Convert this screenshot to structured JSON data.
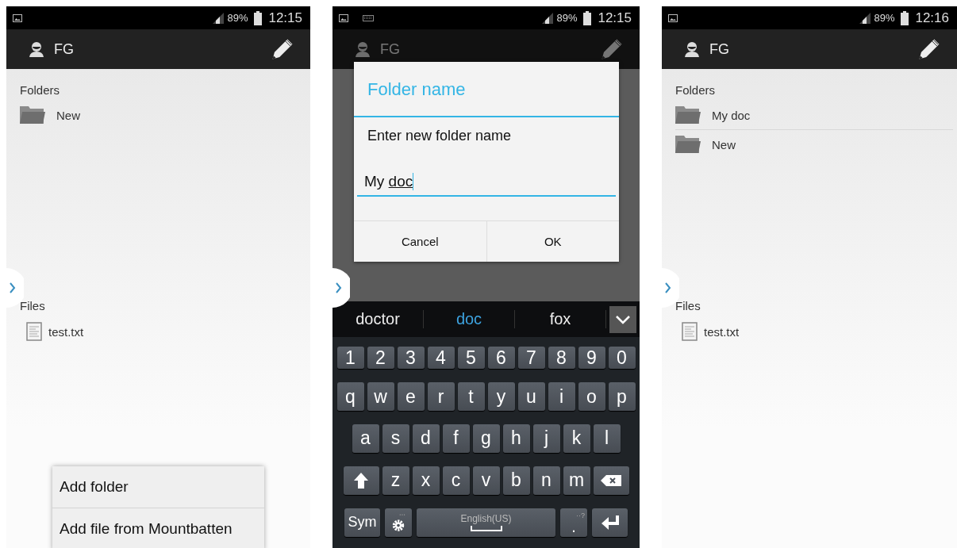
{
  "screens": [
    {
      "kind": "browse",
      "dimmed": false,
      "status_bar": {
        "keyboard_indicator": false,
        "battery": "89%",
        "time": "12:15"
      },
      "app_bar": {
        "title": "FG"
      },
      "folders_heading": "Folders",
      "folders": [
        "New"
      ],
      "files_heading": "Files",
      "files": [
        "test.txt"
      ],
      "menu": {
        "items": [
          "Add folder",
          "Add file from Mountbatten"
        ]
      }
    },
    {
      "kind": "dialog",
      "dimmed": true,
      "status_bar": {
        "keyboard_indicator": true,
        "battery": "89%",
        "time": "12:15"
      },
      "app_bar": {
        "title": "FG"
      },
      "dialog": {
        "title": "Folder name",
        "message": "Enter new folder name",
        "typed": "My ",
        "composing": "doc",
        "buttons": [
          "Cancel",
          "OK"
        ]
      },
      "keyboard": {
        "suggestions": [
          {
            "text": "doctor",
            "selected": false
          },
          {
            "text": "doc",
            "selected": true
          },
          {
            "text": "fox",
            "selected": false
          }
        ],
        "rows": [
          {
            "keys": [
              {
                "kind": "char",
                "label": "1"
              },
              {
                "kind": "char",
                "label": "2"
              },
              {
                "kind": "char",
                "label": "3"
              },
              {
                "kind": "char",
                "label": "4"
              },
              {
                "kind": "char",
                "label": "5"
              },
              {
                "kind": "char",
                "label": "6"
              },
              {
                "kind": "char",
                "label": "7"
              },
              {
                "kind": "char",
                "label": "8"
              },
              {
                "kind": "char",
                "label": "9"
              },
              {
                "kind": "char",
                "label": "0"
              }
            ]
          },
          {
            "keys": [
              {
                "kind": "char",
                "label": "q"
              },
              {
                "kind": "char",
                "label": "w"
              },
              {
                "kind": "char",
                "label": "e"
              },
              {
                "kind": "char",
                "label": "r"
              },
              {
                "kind": "char",
                "label": "t"
              },
              {
                "kind": "char",
                "label": "y"
              },
              {
                "kind": "char",
                "label": "u"
              },
              {
                "kind": "char",
                "label": "i"
              },
              {
                "kind": "char",
                "label": "o"
              },
              {
                "kind": "char",
                "label": "p"
              }
            ]
          },
          {
            "keys": [
              {
                "kind": "char",
                "label": "a"
              },
              {
                "kind": "char",
                "label": "s"
              },
              {
                "kind": "char",
                "label": "d"
              },
              {
                "kind": "char",
                "label": "f"
              },
              {
                "kind": "char",
                "label": "g"
              },
              {
                "kind": "char",
                "label": "h"
              },
              {
                "kind": "char",
                "label": "j"
              },
              {
                "kind": "char",
                "label": "k"
              },
              {
                "kind": "char",
                "label": "l"
              }
            ]
          },
          {
            "keys": [
              {
                "kind": "shift"
              },
              {
                "kind": "char",
                "label": "z"
              },
              {
                "kind": "char",
                "label": "x"
              },
              {
                "kind": "char",
                "label": "c"
              },
              {
                "kind": "char",
                "label": "v"
              },
              {
                "kind": "char",
                "label": "b"
              },
              {
                "kind": "char",
                "label": "n"
              },
              {
                "kind": "char",
                "label": "m"
              },
              {
                "kind": "backspace"
              }
            ]
          },
          {
            "keys": [
              {
                "kind": "sym",
                "label": "Sym"
              },
              {
                "kind": "settings"
              },
              {
                "kind": "space",
                "label": "English(US)"
              },
              {
                "kind": "period",
                "label": ".",
                "hint": "··?"
              },
              {
                "kind": "enter"
              }
            ]
          }
        ]
      }
    },
    {
      "kind": "browse",
      "dimmed": false,
      "status_bar": {
        "keyboard_indicator": false,
        "battery": "89%",
        "time": "12:16"
      },
      "app_bar": {
        "title": "FG"
      },
      "folders_heading": "Folders",
      "folders": [
        "My doc",
        "New"
      ],
      "files_heading": "Files",
      "files": [
        "test.txt"
      ]
    }
  ]
}
